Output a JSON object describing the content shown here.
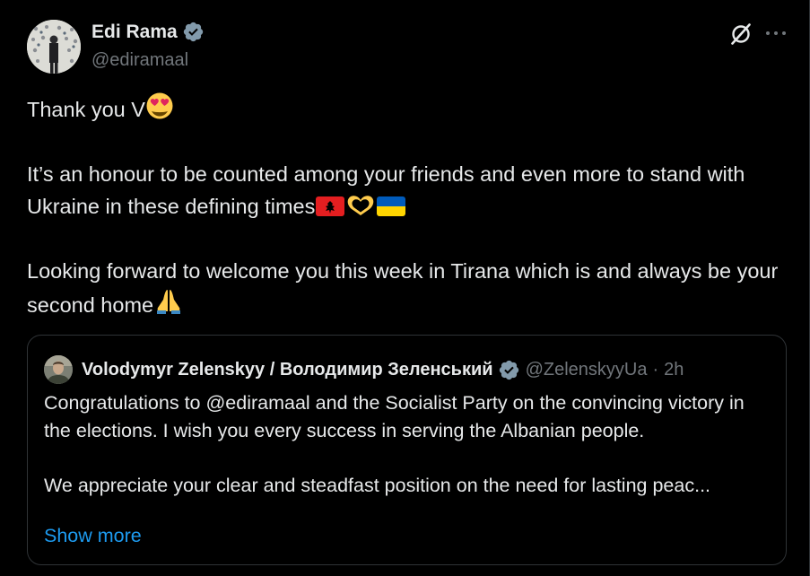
{
  "author": {
    "name": "Edi Rama",
    "handle": "@ediramaal"
  },
  "icons": {
    "verified": "verified-badge-icon",
    "grok": "grok-icon",
    "more": "more-options-icon"
  },
  "colors": {
    "background": "#000000",
    "text": "#e7e9ea",
    "secondary": "#71767b",
    "link": "#1d9bf0",
    "verified": "#829aab",
    "border": "#2f3336"
  },
  "tweet": {
    "line1": "Thank you V",
    "line2": "It’s an honour to be counted among your friends and even more to stand with Ukraine in these defining times",
    "line3": "Looking forward to welcome you this week in Tirana which is and always be your second home",
    "emojis": [
      "heart-eyes-emoji",
      "albania-flag-emoji",
      "heart-hands-emoji",
      "ukraine-flag-emoji",
      "folded-hands-emoji"
    ]
  },
  "quote": {
    "name": "Volodymyr Zelenskyy / Володимир Зеленський",
    "handle": "@ZelenskyyUa",
    "separator": "·",
    "time": "2h",
    "para1": "Congratulations to @ediramaal and the Socialist Party on the convincing victory in the elections. I wish you every success in serving the Albanian people.",
    "para2": "We appreciate your clear and steadfast position on the need for lasting peac...",
    "show_more": "Show more"
  }
}
